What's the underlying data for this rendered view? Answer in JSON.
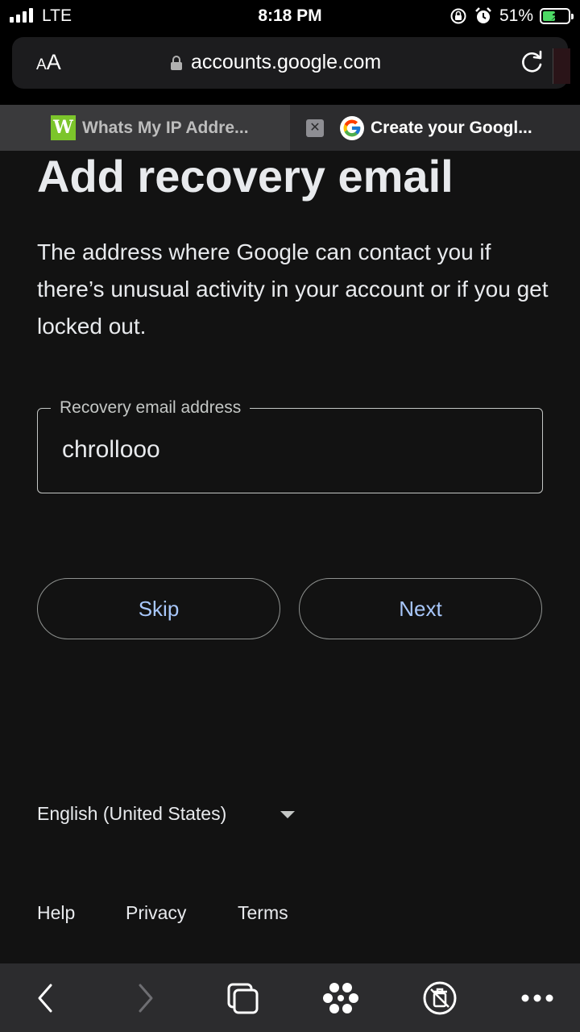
{
  "status_bar": {
    "carrier": "LTE",
    "time": "8:18 PM",
    "battery_percent": "51%",
    "battery_level": 0.51
  },
  "browser": {
    "text_size_button": {
      "small": "A",
      "large": "A"
    },
    "url": "accounts.google.com",
    "tabs": [
      {
        "title": "Whats My IP Addre...",
        "favicon": "W"
      },
      {
        "title": "Create your Googl..."
      }
    ]
  },
  "page": {
    "title": "Add recovery email",
    "description": "The address where Google can contact you if there’s unusual activity in your account or if you get locked out.",
    "field": {
      "label": "Recovery email address",
      "value": "chrollooo"
    },
    "skip_label": "Skip",
    "next_label": "Next",
    "language": "English (United States)",
    "footer": {
      "help": "Help",
      "privacy": "Privacy",
      "terms": "Terms"
    }
  },
  "colors": {
    "accent": "#a8c7fa",
    "background": "#121212",
    "battery_fill": "#4cd964"
  }
}
